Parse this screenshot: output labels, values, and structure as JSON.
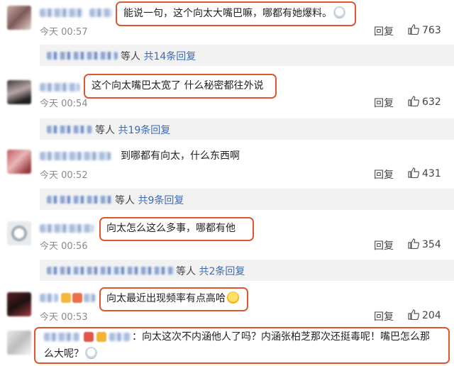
{
  "comments": [
    {
      "text": "能说一句，这个向太大嘴巴嘛，哪都有她爆料。",
      "time": "今天 00:57",
      "reply_label": "回复",
      "likes": "763",
      "emoji": "white-face-emoji",
      "replies": {
        "suffix": "等人",
        "link": "共14条回复"
      }
    },
    {
      "text": "这个向太嘴巴太宽了 什么秘密都往外说",
      "time": "今天 00:54",
      "reply_label": "回复",
      "likes": "632",
      "replies": {
        "suffix": "等人",
        "link": "共19条回复"
      }
    },
    {
      "text": "到哪都有向太，什么东西啊",
      "time": "今天 00:52",
      "reply_label": "回复",
      "likes": "431",
      "replies": {
        "suffix": "等人",
        "link": "共9条回复"
      }
    },
    {
      "text": "向太怎么这么多事，哪都有他",
      "time": "今天 00:56",
      "reply_label": "回复",
      "likes": "354",
      "replies": {
        "suffix": "等人",
        "link": "共2条回复"
      }
    },
    {
      "text": "向太最近出现频率有点高哈",
      "time": "今天 00:53",
      "reply_label": "回复",
      "likes": "204",
      "emoji": "laughing-tears-emoji"
    },
    {
      "text_line1": "：向太这次不内涵他人了吗？内涵张柏芝那次还挺毒呢！嘴巴怎么那",
      "text_line2": "么大呢？",
      "emoji": "white-face-emoji"
    }
  ],
  "colors": {
    "highlight_border": "#e0572e",
    "link": "#3b6bb4",
    "time": "#8a8a8a",
    "reply_bar": "#f2f2f2"
  },
  "icons": {
    "like": "thumbs-up-icon"
  }
}
